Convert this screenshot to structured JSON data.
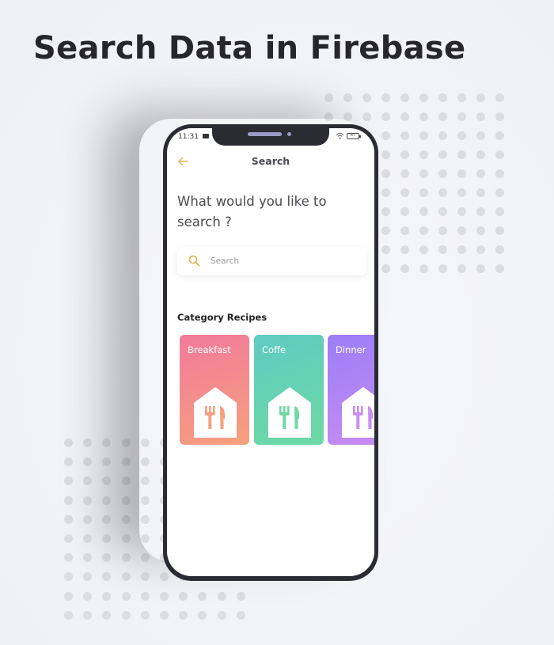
{
  "headline": "Search Data in Firebase",
  "phone": {
    "status_bar": {
      "time": "11:31",
      "battery_level": "87",
      "icons": [
        "message-icon",
        "wifi-icon",
        "battery-icon"
      ]
    },
    "nav": {
      "back_icon": "arrow-left-icon",
      "title": "Search"
    },
    "prompt": "What would you like to search ?",
    "search": {
      "icon": "search-icon",
      "placeholder": "Search",
      "value": ""
    },
    "section_title": "Category Recipes",
    "categories": [
      {
        "label": "Breakfast",
        "icon": "restaurant-house-icon",
        "color_start": "#f27a9b",
        "color_end": "#f5a17e"
      },
      {
        "label": "Coffe",
        "icon": "restaurant-house-icon",
        "color_start": "#5ecbc2",
        "color_end": "#6ed9a3"
      },
      {
        "label": "Dinner",
        "icon": "restaurant-house-icon",
        "color_start": "#9a7ef6",
        "color_end": "#c98cf1"
      }
    ]
  },
  "colors": {
    "accent": "#e0b24a",
    "frame": "#2b2b33",
    "headline": "#26262c"
  }
}
